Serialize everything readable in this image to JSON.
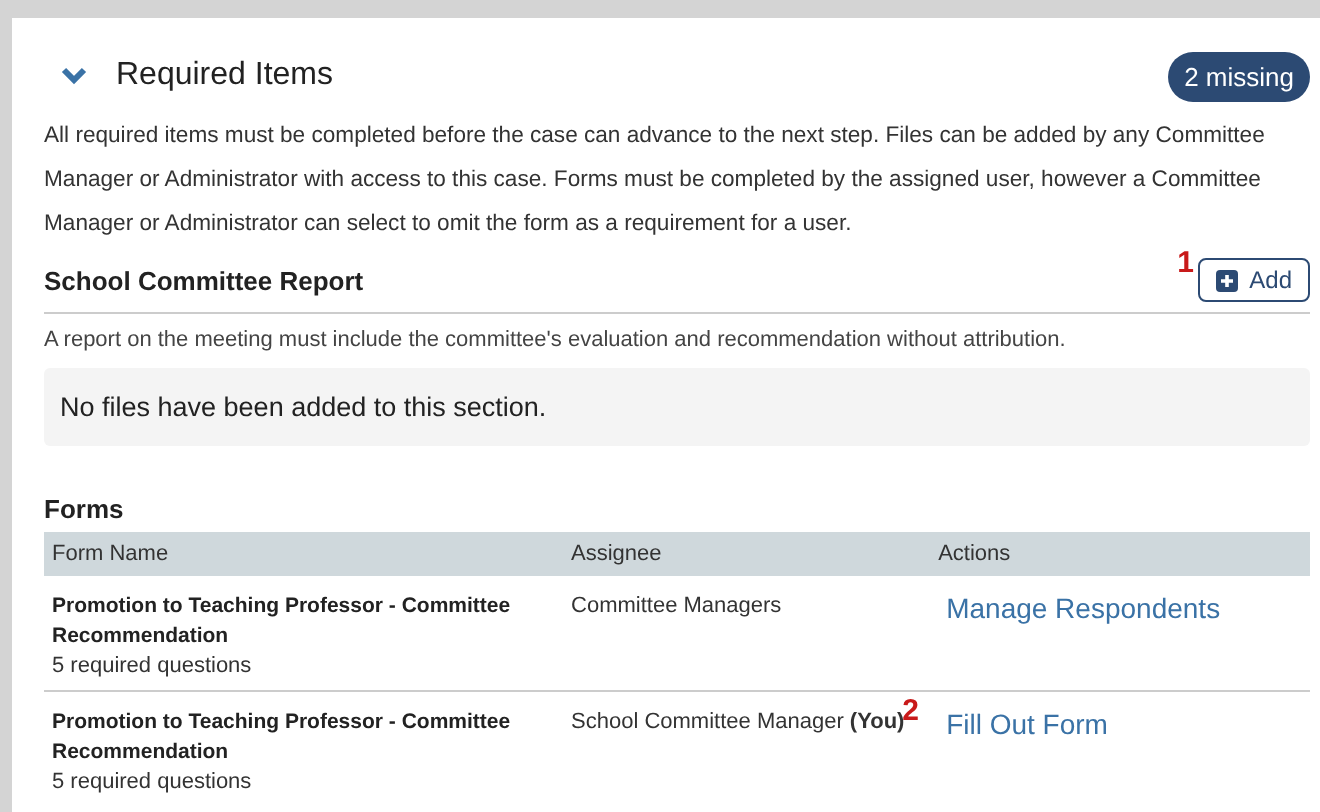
{
  "section": {
    "title": "Required Items",
    "expanded": true,
    "badge": "2 missing",
    "description": "All required items must be completed before the case can advance to the next step. Files can be added by any Committee Manager or Administrator with access to this case. Forms must be completed by the assigned user, however a Committee Manager or Administrator can select to omit the form as a requirement for a user."
  },
  "report": {
    "title": "School Committee Report",
    "marker": "1",
    "add_button": "Add",
    "description": "A report on the meeting must include the committee's evaluation and recommendation without attribution.",
    "empty_message": "No files have been added to this section."
  },
  "forms": {
    "title": "Forms",
    "columns": [
      "Form Name",
      "Assignee",
      "Actions"
    ],
    "rows": [
      {
        "name": "Promotion to Teaching Professor - Committee Recommendation",
        "detail": "5 required questions",
        "assignee": "Committee Managers",
        "marker": "",
        "action": "Manage Respondents"
      },
      {
        "name": "Promotion to Teaching Professor - Committee Recommendation",
        "detail": "5 required questions",
        "assignee": "School Committee Manager **(You)**",
        "marker": "2",
        "action": "Fill Out Form"
      }
    ]
  }
}
